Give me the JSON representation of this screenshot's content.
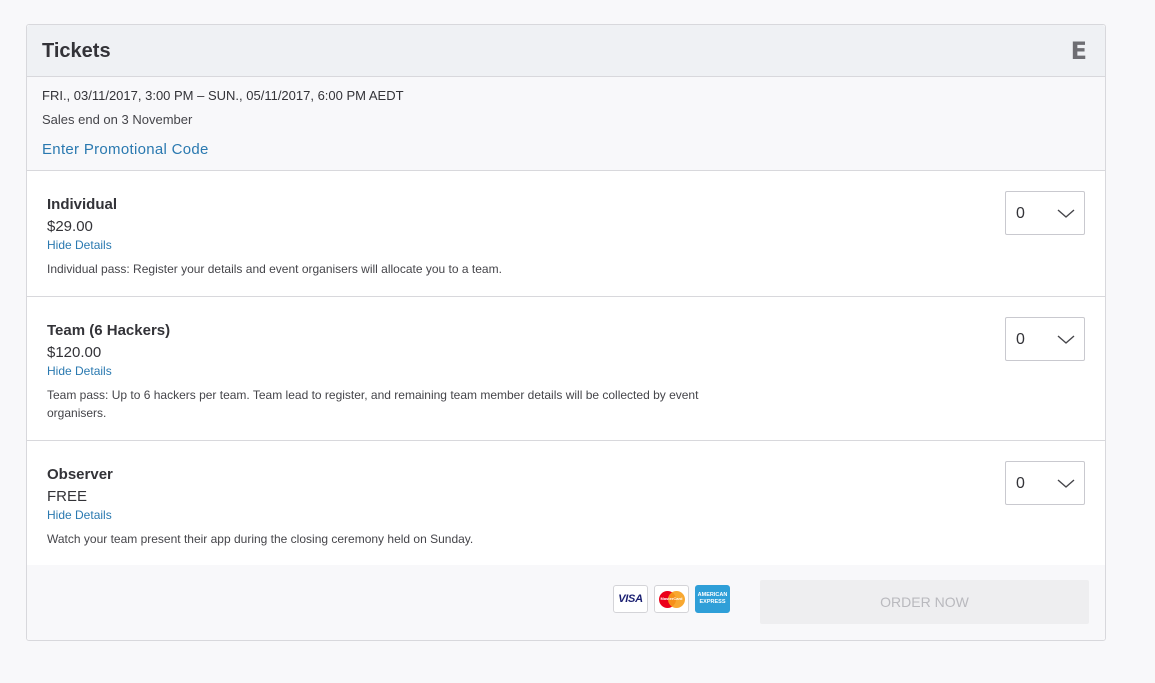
{
  "panel": {
    "title": "Tickets",
    "brand_logo": "E"
  },
  "event": {
    "dates": "FRI., 03/11/2017, 3:00 PM – SUN., 05/11/2017, 6:00 PM AEDT",
    "sales_end": "Sales end on 3 November",
    "promo_link": "Enter Promotional Code"
  },
  "tickets": [
    {
      "name": "Individual",
      "price": "$29.00",
      "details_toggle": "Hide Details",
      "description": "Individual pass: Register your details and event organisers will allocate you to a team.",
      "quantity": "0"
    },
    {
      "name": "Team (6 Hackers)",
      "price": "$120.00",
      "details_toggle": "Hide Details",
      "description": "Team pass: Up to 6 hackers per team. Team lead to register, and remaining team member details will be collected by event organisers.",
      "quantity": "0"
    },
    {
      "name": "Observer",
      "price": "FREE",
      "details_toggle": "Hide Details",
      "description": "Watch your team present their app during the closing ceremony held on Sunday.",
      "quantity": "0"
    }
  ],
  "footer": {
    "payment_cards": {
      "visa": "VISA",
      "mastercard": "MasterCard",
      "amex": "AMERICAN EXPRESS"
    },
    "order_button": "ORDER NOW"
  },
  "colors": {
    "link": "#2a79b0",
    "header_bg": "#eff1f4",
    "disabled_button_bg": "#eeeef0",
    "disabled_button_text": "#b9b9be"
  },
  "icons": {
    "quantity_dropdown": "chevron-down-icon",
    "brand": "eventbrite-logo-icon"
  }
}
